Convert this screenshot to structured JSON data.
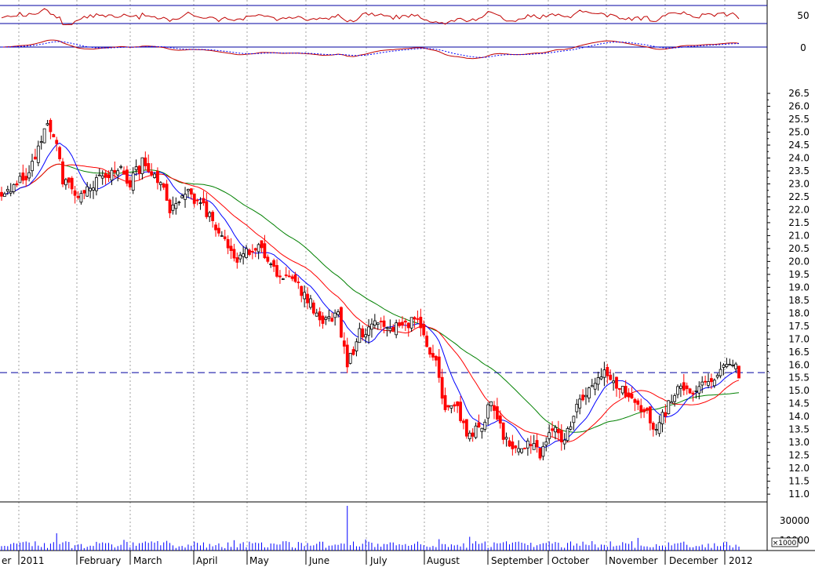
{
  "chart_data": {
    "type": "candlestick",
    "colors": {
      "up": "#000000",
      "down": "#ff0000",
      "ma_short": "#0000ff",
      "ma_mid": "#ff0000",
      "ma_long": "#008000",
      "rsi": "#c00000",
      "macd": "#c00000",
      "signal": "#0000ff",
      "volume": "#0000ff",
      "reference": "#0000a0",
      "grid": "#a0a0a0"
    },
    "months": [
      "er",
      "2011",
      "February",
      "March",
      "April",
      "May",
      "June",
      "July",
      "August",
      "September",
      "October",
      "November",
      "December",
      "2012"
    ],
    "price_axis": {
      "ylim": [
        10.7,
        27.2
      ],
      "ticks": [
        "11.0",
        "11.5",
        "12.0",
        "12.5",
        "13.0",
        "13.5",
        "14.0",
        "14.5",
        "15.0",
        "15.5",
        "16.0",
        "16.5",
        "17.0",
        "17.5",
        "18.0",
        "18.5",
        "19.0",
        "19.5",
        "20.0",
        "20.5",
        "21.0",
        "21.5",
        "22.0",
        "22.5",
        "23.0",
        "23.5",
        "24.0",
        "24.5",
        "25.0",
        "25.5",
        "26.0",
        "26.5"
      ],
      "reference_line": 15.7
    },
    "rsi_panel": {
      "ticks": [
        "50"
      ]
    },
    "macd_panel": {
      "ticks": [
        "0"
      ]
    },
    "volume_panel": {
      "ticks": [
        "30000",
        "10000"
      ],
      "unit_label": "×1000"
    },
    "price_anchors": [
      {
        "i": 0,
        "c": 22.7
      },
      {
        "i": 8,
        "c": 23.3
      },
      {
        "i": 15,
        "c": 25.2
      },
      {
        "i": 18,
        "c": 24.6
      },
      {
        "i": 20,
        "c": 23.2
      },
      {
        "i": 26,
        "c": 22.5
      },
      {
        "i": 33,
        "c": 23.3
      },
      {
        "i": 38,
        "c": 23.6
      },
      {
        "i": 42,
        "c": 23.1
      },
      {
        "i": 46,
        "c": 23.8
      },
      {
        "i": 50,
        "c": 23.5
      },
      {
        "i": 55,
        "c": 22.1
      },
      {
        "i": 60,
        "c": 22.7
      },
      {
        "i": 64,
        "c": 22.3
      },
      {
        "i": 68,
        "c": 21.8
      },
      {
        "i": 72,
        "c": 21.0
      },
      {
        "i": 76,
        "c": 20.1
      },
      {
        "i": 80,
        "c": 20.3
      },
      {
        "i": 85,
        "c": 20.5
      },
      {
        "i": 90,
        "c": 19.4
      },
      {
        "i": 95,
        "c": 19.3
      },
      {
        "i": 100,
        "c": 18.6
      },
      {
        "i": 105,
        "c": 17.6
      },
      {
        "i": 110,
        "c": 17.9
      },
      {
        "i": 113,
        "c": 16.0
      },
      {
        "i": 117,
        "c": 17.2
      },
      {
        "i": 122,
        "c": 17.6
      },
      {
        "i": 127,
        "c": 17.3
      },
      {
        "i": 132,
        "c": 17.7
      },
      {
        "i": 137,
        "c": 17.5
      },
      {
        "i": 142,
        "c": 16.0
      },
      {
        "i": 145,
        "c": 14.2
      },
      {
        "i": 149,
        "c": 14.4
      },
      {
        "i": 152,
        "c": 13.3
      },
      {
        "i": 157,
        "c": 13.6
      },
      {
        "i": 160,
        "c": 14.6
      },
      {
        "i": 164,
        "c": 13.2
      },
      {
        "i": 168,
        "c": 12.6
      },
      {
        "i": 172,
        "c": 13.0
      },
      {
        "i": 176,
        "c": 12.5
      },
      {
        "i": 180,
        "c": 13.6
      },
      {
        "i": 184,
        "c": 13.0
      },
      {
        "i": 188,
        "c": 14.5
      },
      {
        "i": 192,
        "c": 15.0
      },
      {
        "i": 197,
        "c": 15.6
      },
      {
        "i": 201,
        "c": 15.2
      },
      {
        "i": 205,
        "c": 14.7
      },
      {
        "i": 210,
        "c": 14.3
      },
      {
        "i": 214,
        "c": 13.4
      },
      {
        "i": 218,
        "c": 14.5
      },
      {
        "i": 222,
        "c": 15.2
      },
      {
        "i": 226,
        "c": 14.9
      },
      {
        "i": 230,
        "c": 15.2
      },
      {
        "i": 234,
        "c": 15.7
      },
      {
        "i": 238,
        "c": 16.1
      },
      {
        "i": 241,
        "c": 15.7
      }
    ]
  }
}
